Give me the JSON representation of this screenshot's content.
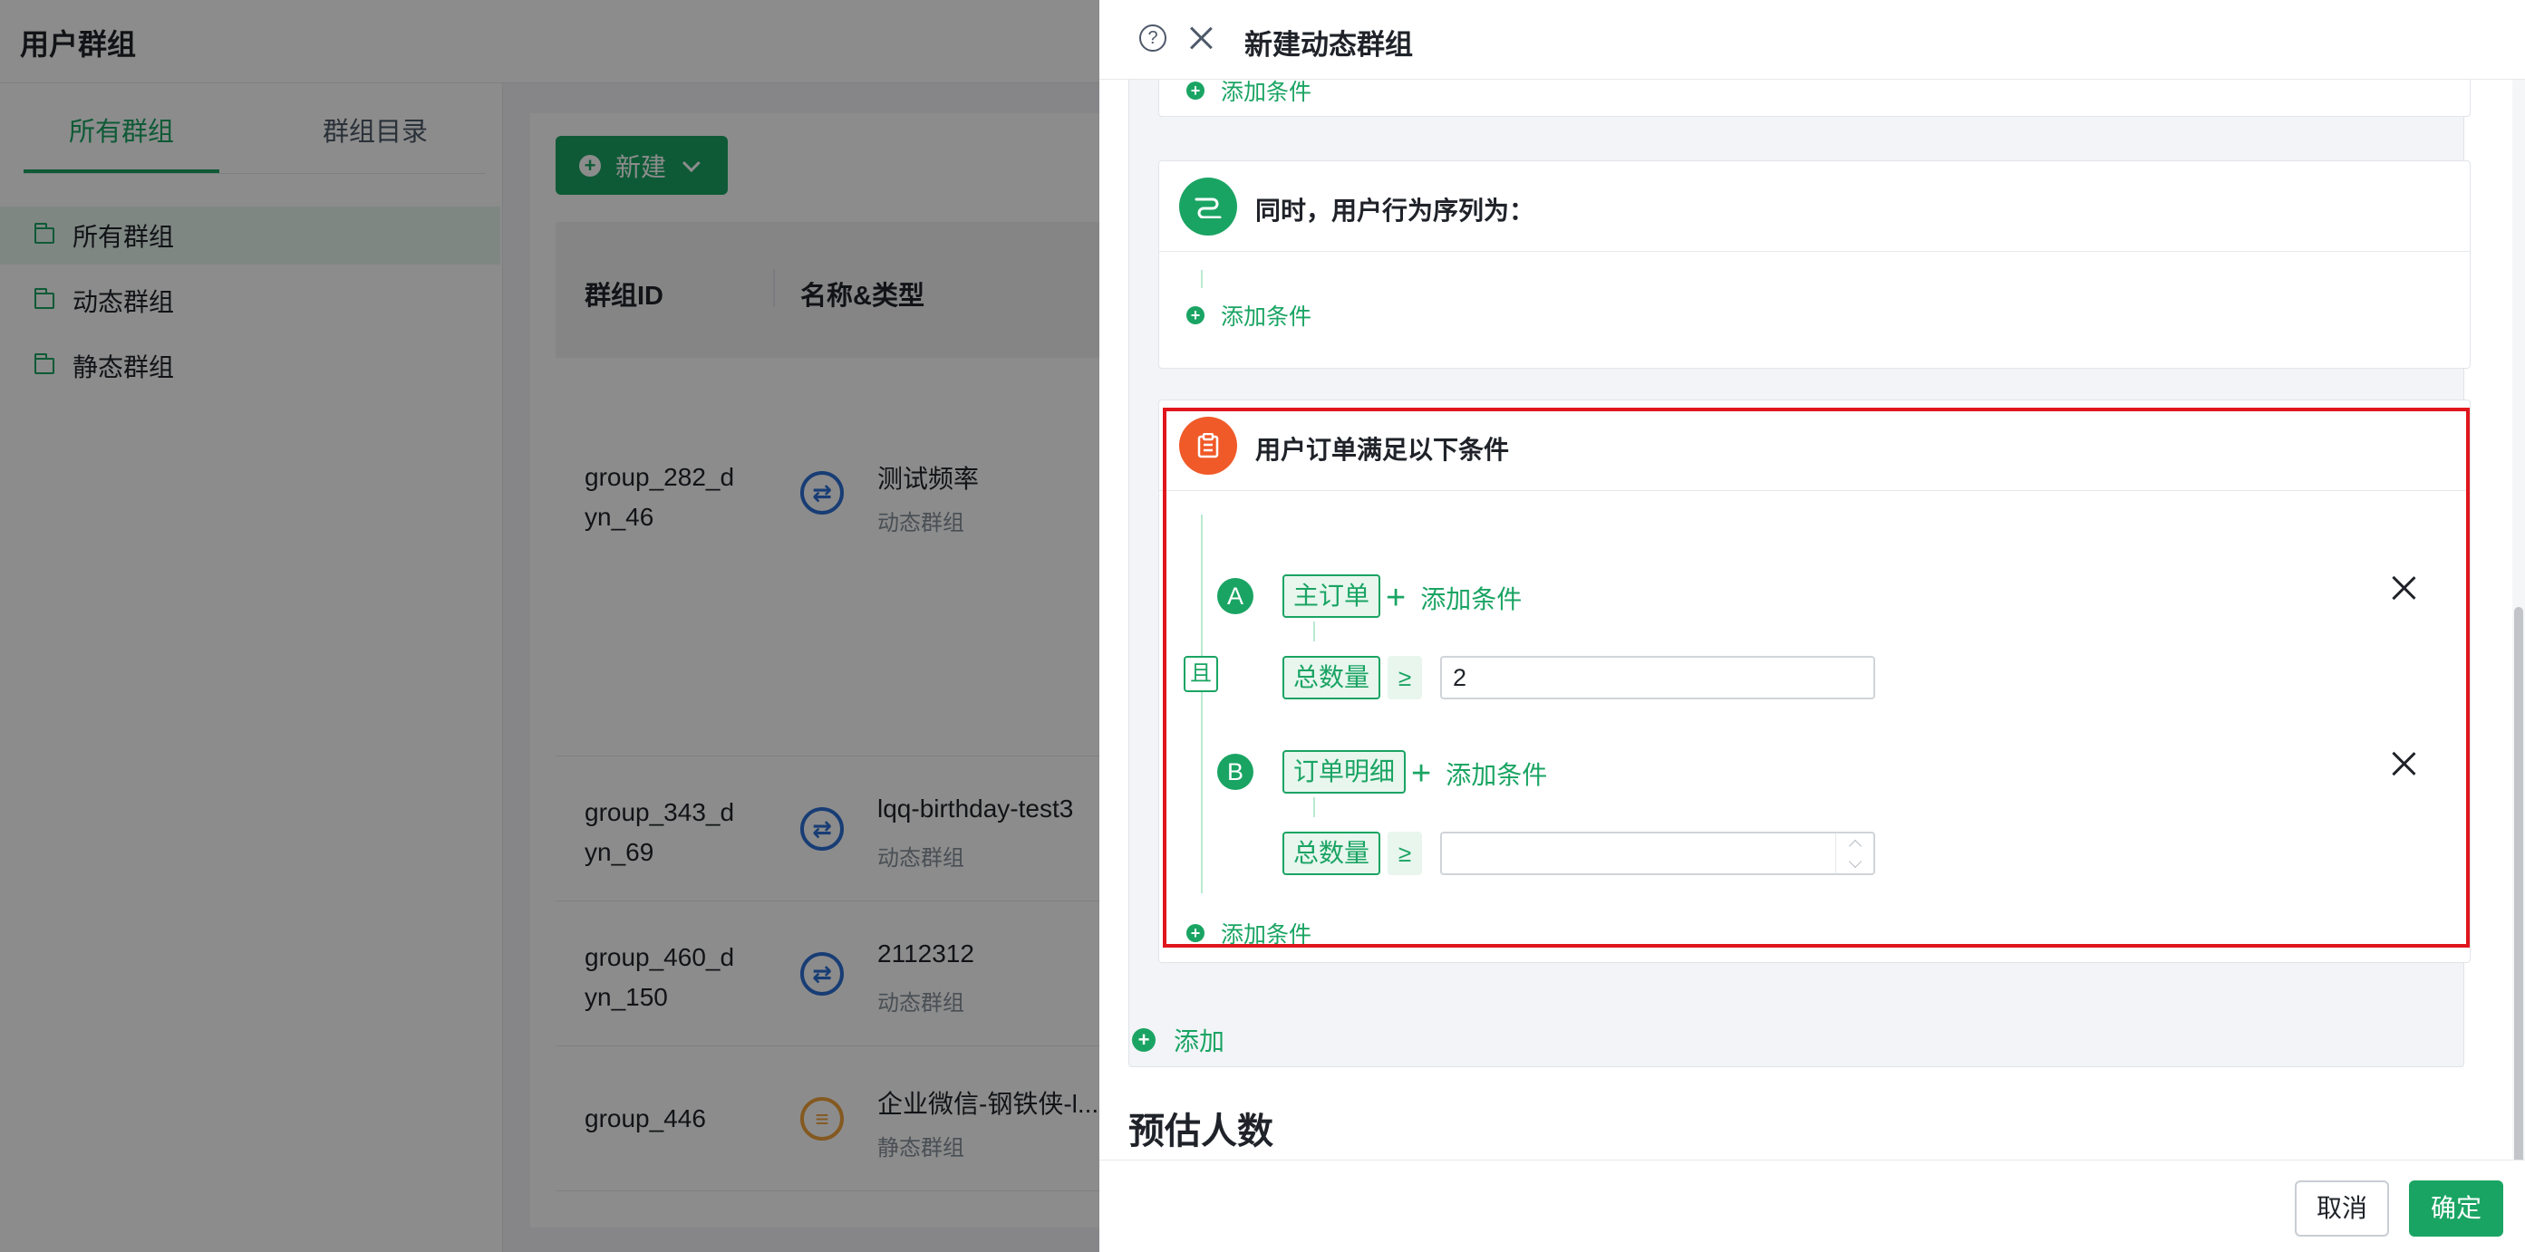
{
  "app": {
    "title": "用户群组",
    "tabs": [
      "所有群组",
      "群组目录"
    ],
    "tree": [
      "所有群组",
      "动态群组",
      "静态群组"
    ],
    "new_button": "新建",
    "columns": [
      "群组ID",
      "名称&类型"
    ],
    "rows": [
      {
        "id": "group_282_d\nyn_46",
        "name": "测试频率",
        "type": "动态群组"
      },
      {
        "id": "group_343_d\nyn_69",
        "name": "lqq-birthday-test3",
        "type": "动态群组"
      },
      {
        "id": "group_460_d\nyn_150",
        "name": "2112312",
        "type": "动态群组"
      },
      {
        "id": "group_446",
        "name": "企业微信-钢铁侠-l...",
        "type": "静态群组"
      }
    ]
  },
  "drawer": {
    "title": "新建动态群组",
    "top_add_condition": "添加条件",
    "sequence_card": {
      "title": "同时，用户行为序列为：",
      "add_condition": "添加条件"
    },
    "order_card": {
      "title": "用户订单满足以下条件",
      "and_label": "且",
      "groups": [
        {
          "letter": "A",
          "tag": "主订单",
          "add_condition": "添加条件",
          "metric": "总数量",
          "op": "≥",
          "value": "2"
        },
        {
          "letter": "B",
          "tag": "订单明细",
          "add_condition": "添加条件",
          "metric": "总数量",
          "op": "≥",
          "value": ""
        }
      ],
      "add_condition": "添加条件"
    },
    "add_link": "添加",
    "estimate_title": "预估人数",
    "footer": {
      "cancel": "取消",
      "confirm": "确定"
    }
  },
  "colors": {
    "accent": "#1aa463",
    "highlight": "#e0161d",
    "order_icon": "#f05a28"
  }
}
